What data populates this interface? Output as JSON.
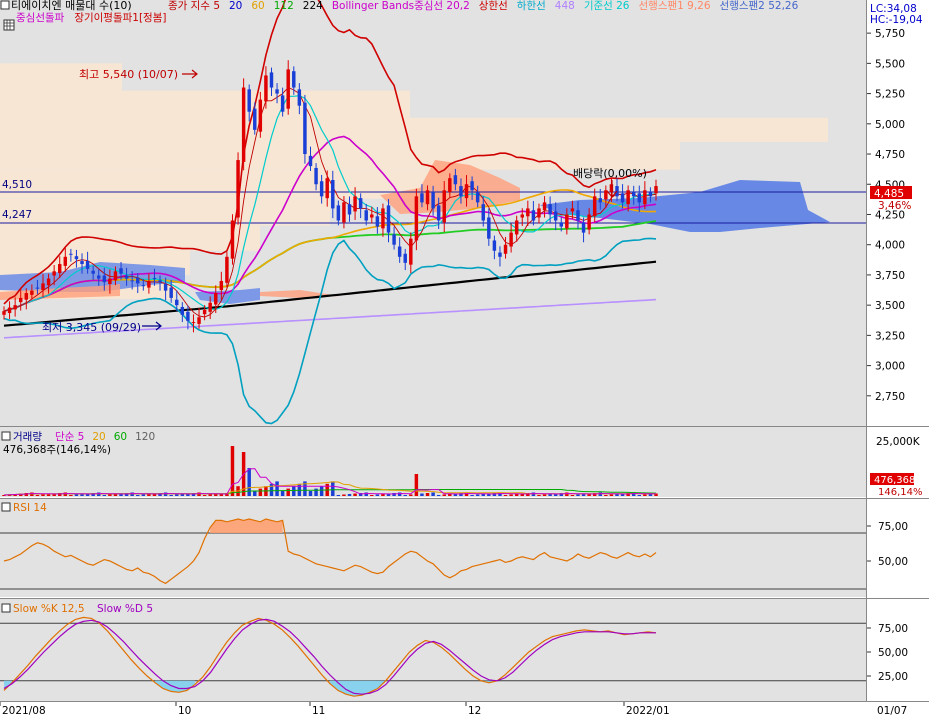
{
  "header": {
    "title": "티에이치엔 매물대 수(10)",
    "legend": [
      {
        "text": "종가 지수 5",
        "color": "#c00000"
      },
      {
        "text": "20",
        "color": "#0000cc"
      },
      {
        "text": "60",
        "color": "#e0a000"
      },
      {
        "text": "112",
        "color": "#00aa00"
      },
      {
        "text": "224",
        "color": "#000000"
      },
      {
        "text": "Bollinger Bands중심선 20,2",
        "color": "#cc00cc"
      },
      {
        "text": "상한선",
        "color": "#cc0000"
      },
      {
        "text": "하한선",
        "color": "#00aacc"
      },
      {
        "text": "448",
        "color": "#b080ff"
      },
      {
        "text": "기준선 26",
        "color": "#00cccc"
      },
      {
        "text": "선행스팬1 9,26",
        "color": "#ff8866"
      },
      {
        "text": "선행스팬2 52,26",
        "color": "#4466cc"
      }
    ],
    "legend2": [
      {
        "text": "중심선돌파",
        "color": "#cc00cc"
      },
      {
        "text": "장기이평돌파1[정봄]",
        "color": "#cc0000"
      }
    ],
    "right_top": [
      "LC:34,08",
      "HC:-19,04"
    ]
  },
  "colors": {
    "up": "#e00000",
    "down": "#1a3fd6",
    "grid": "#404040",
    "panel_bg": "#e2e2e2",
    "volume_profile": "#f7e6d4"
  },
  "chart_data": [
    {
      "type": "candlestick",
      "panel": "price",
      "y_ticks": [
        "5,750",
        "5,500",
        "5,250",
        "5,000",
        "4,750",
        "4,500",
        "4,250",
        "4,000",
        "3,750",
        "3,500",
        "3,250",
        "3,000",
        "2,750"
      ],
      "ylim": [
        2550,
        5900
      ],
      "hlines": [
        {
          "label": "4,510",
          "value": 4510
        },
        {
          "label": "4,247",
          "value": 4247
        }
      ],
      "current": {
        "label": "4,485",
        "value": 4485,
        "pct": "3,46%"
      },
      "annotations": [
        {
          "text": "최고 5,540 (10/07)",
          "value": 5540
        },
        {
          "text": "최저 3,345 (09/29)",
          "value": 3345
        },
        {
          "text": "배당락(0,00%)"
        }
      ],
      "x_ticks": [
        "2021/08",
        "10",
        "11",
        "12",
        "2022/01",
        "01/07"
      ],
      "closes": [
        3450,
        3480,
        3500,
        3560,
        3600,
        3620,
        3640,
        3680,
        3720,
        3780,
        3840,
        3900,
        3920,
        3880,
        3840,
        3800,
        3760,
        3720,
        3690,
        3720,
        3780,
        3760,
        3720,
        3700,
        3680,
        3660,
        3700,
        3720,
        3690,
        3620,
        3560,
        3500,
        3420,
        3370,
        3360,
        3400,
        3460,
        3520,
        3600,
        3700,
        3900,
        4200,
        4700,
        5300,
        5100,
        4950,
        5200,
        5400,
        5300,
        5250,
        5100,
        5450,
        5300,
        5150,
        4750,
        4650,
        4500,
        4400,
        4550,
        4300,
        4200,
        4350,
        4250,
        4400,
        4300,
        4200,
        4250,
        4150,
        4300,
        4100,
        4000,
        3900,
        3850,
        4050,
        4400,
        4350,
        4450,
        4300,
        4200,
        4450,
        4550,
        4500,
        4400,
        4500,
        4450,
        4350,
        4200,
        4050,
        3950,
        3900,
        4000,
        4100,
        4200,
        4250,
        4300,
        4200,
        4300,
        4350,
        4250,
        4200,
        4150,
        4250,
        4300,
        4200,
        4100,
        4250,
        4400,
        4350,
        4450,
        4500,
        4400,
        4350,
        4450,
        4400,
        4350,
        4450,
        4400,
        4485
      ],
      "volume": {
        "label": "거래량",
        "legend": [
          {
            "text": "단순 5",
            "color": "#cc00cc"
          },
          {
            "text": "20",
            "color": "#e0a000"
          },
          {
            "text": "60",
            "color": "#00aa00"
          },
          {
            "text": "120",
            "color": "#606060"
          }
        ],
        "value_text": "476,368주(146,14%)",
        "y_ticks": [
          "25,000K"
        ],
        "current": "476,368",
        "current_pct": "146,14%",
        "spikes": [
          {
            "index": 41,
            "value": 25000
          },
          {
            "index": 43,
            "value": 22000
          },
          {
            "index": 44,
            "value": 14000
          },
          {
            "index": 74,
            "value": 11000
          }
        ]
      }
    },
    {
      "type": "line",
      "panel": "rsi",
      "title": "RSI 14",
      "y_ticks": [
        "75,00",
        "50,00"
      ],
      "ylim": [
        25,
        90
      ],
      "values": [
        50,
        51,
        53,
        55,
        58,
        61,
        63,
        62,
        60,
        57,
        55,
        53,
        54,
        52,
        50,
        48,
        47,
        49,
        51,
        50,
        48,
        46,
        44,
        43,
        45,
        42,
        41,
        39,
        36,
        34,
        37,
        40,
        43,
        46,
        50,
        56,
        66,
        74,
        79,
        79,
        78,
        79,
        80,
        79,
        80,
        79,
        78,
        80,
        79,
        78,
        79,
        57,
        55,
        54,
        52,
        50,
        48,
        47,
        46,
        45,
        44,
        43,
        45,
        47,
        46,
        44,
        42,
        41,
        42,
        46,
        49,
        52,
        55,
        57,
        56,
        53,
        50,
        48,
        44,
        40,
        38,
        40,
        43,
        44,
        46,
        47,
        48,
        49,
        50,
        51,
        49,
        50,
        52,
        53,
        52,
        51,
        54,
        56,
        53,
        52,
        51,
        50,
        52,
        55,
        53,
        52,
        54,
        56,
        55,
        53,
        52,
        54,
        56,
        54,
        53,
        55,
        53,
        56
      ]
    },
    {
      "type": "line",
      "panel": "stochastic",
      "title": "Slow %K 12,5",
      "series": [
        {
          "name": "Slow %K 12,5",
          "color": "#e07000",
          "values": [
            10,
            18,
            27,
            36,
            46,
            55,
            64,
            72,
            79,
            84,
            86,
            85,
            80,
            72,
            62,
            52,
            42,
            33,
            25,
            18,
            12,
            9,
            8,
            10,
            16,
            24,
            35,
            48,
            60,
            70,
            78,
            82,
            85,
            83,
            79,
            73,
            65,
            56,
            46,
            36,
            26,
            17,
            10,
            6,
            4,
            5,
            8,
            12,
            20,
            30,
            40,
            50,
            57,
            62,
            60,
            55,
            48,
            40,
            32,
            25,
            20,
            18,
            20,
            26,
            34,
            42,
            50,
            56,
            62,
            66,
            68,
            70,
            72,
            73,
            72,
            71,
            72,
            70,
            68,
            69,
            70,
            71,
            70
          ]
        },
        {
          "name": "Slow %D 5",
          "color": "#a000c0",
          "values": [
            12,
            17,
            24,
            32,
            41,
            50,
            58,
            66,
            73,
            79,
            82,
            83,
            81,
            76,
            69,
            61,
            52,
            43,
            35,
            27,
            20,
            15,
            12,
            12,
            14,
            20,
            29,
            41,
            53,
            64,
            73,
            79,
            83,
            84,
            82,
            77,
            71,
            63,
            54,
            45,
            35,
            26,
            18,
            11,
            7,
            6,
            7,
            10,
            16,
            25,
            35,
            45,
            53,
            59,
            61,
            58,
            52,
            45,
            38,
            31,
            25,
            21,
            20,
            23,
            29,
            37,
            45,
            52,
            58,
            63,
            66,
            68,
            70,
            71,
            71,
            71,
            71,
            70,
            69,
            69,
            70,
            70,
            70
          ]
        }
      ],
      "y_ticks": [
        "75,00",
        "50,00",
        "25,00"
      ],
      "ylim": [
        0,
        100
      ]
    }
  ]
}
